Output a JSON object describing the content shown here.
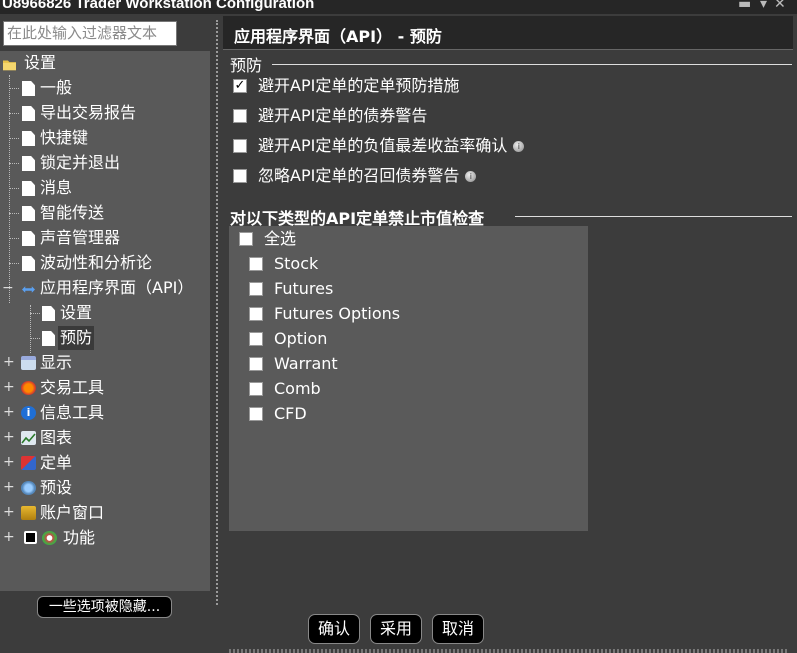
{
  "window": {
    "title": "U8966826 Trader Workstation Configuration"
  },
  "filter": {
    "placeholder": "在此处输入过滤器文本"
  },
  "tree": {
    "root": "设置",
    "items": [
      "一般",
      "导出交易报告",
      "快捷键",
      "锁定并退出",
      "消息",
      "智能传送",
      "声音管理器",
      "波动性和分析论",
      "应用程序界面（API）"
    ],
    "api_children": [
      "设置",
      "预防"
    ],
    "groups": [
      "显示",
      "交易工具",
      "信息工具",
      "图表",
      "定单",
      "预设",
      "账户窗口",
      "功能"
    ]
  },
  "hidden_button": "一些选项被隐藏...",
  "header": {
    "title": "应用程序界面（API） - 预防"
  },
  "precautions": {
    "title": "预防",
    "options": [
      {
        "label": "避开API定单的定单预防措施",
        "checked": true,
        "info": false
      },
      {
        "label": "避开API定单的债券警告",
        "checked": false,
        "info": false
      },
      {
        "label": "避开API定单的负值最差收益率确认",
        "checked": false,
        "info": true
      },
      {
        "label": "忽略API定单的召回债券警告",
        "checked": false,
        "info": true
      }
    ]
  },
  "market_value": {
    "title": "对以下类型的API定单禁止市值检查",
    "select_all": "全选",
    "types": [
      "Stock",
      "Futures",
      "Futures Options",
      "Option",
      "Warrant",
      "Comb",
      "CFD"
    ]
  },
  "buttons": {
    "ok": "确认",
    "apply": "采用",
    "cancel": "取消"
  },
  "colors": {
    "background": "#3c3c3c",
    "tree_background": "#595959",
    "panel": "#5a5a5a",
    "header": "#262626"
  },
  "icons": {
    "check_mark": "✓",
    "info": "i",
    "group_icons": [
      "display-icon",
      "trading-tools-icon",
      "info-tools-icon",
      "charts-icon",
      "orders-icon",
      "presets-icon",
      "account-icon",
      "features-icon"
    ]
  }
}
